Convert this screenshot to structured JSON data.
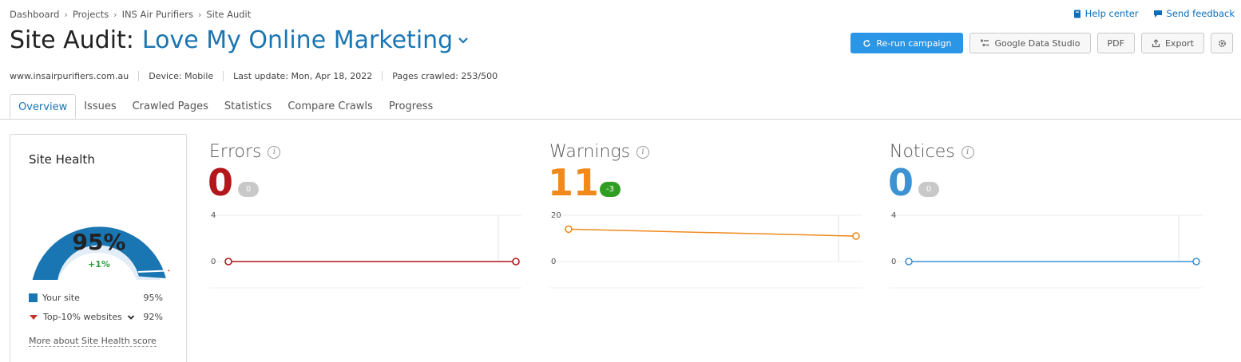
{
  "breadcrumb": [
    "Dashboard",
    "Projects",
    "INS Air Purifiers",
    "Site Audit"
  ],
  "top_links": {
    "help": "Help center",
    "feedback": "Send feedback"
  },
  "title": {
    "static": "Site Audit:",
    "project": "Love My Online Marketing"
  },
  "actions": {
    "rerun": "Re-run campaign",
    "gds": "Google Data Studio",
    "pdf": "PDF",
    "export": "Export"
  },
  "meta": {
    "domain": "www.insairpurifiers.com.au",
    "device": "Device: Mobile",
    "last_update": "Last update: Mon, Apr 18, 2022",
    "pages_crawled": "Pages crawled: 253/500"
  },
  "tabs": [
    "Overview",
    "Issues",
    "Crawled Pages",
    "Statistics",
    "Compare Crawls",
    "Progress"
  ],
  "active_tab": "Overview",
  "site_health": {
    "title": "Site Health",
    "score": "95%",
    "score_value": 95,
    "top10_value": 92,
    "delta": "+1%",
    "legend": [
      {
        "label": "Your site",
        "value": "95%"
      },
      {
        "label": "Top-10% websites",
        "value": "92%"
      }
    ],
    "link": "More about Site Health score"
  },
  "metrics": [
    {
      "name": "Errors",
      "value": "0",
      "badge": "0",
      "color": "#b3161b",
      "badge_color": "#c8c8c8",
      "chart": {
        "ymax_label": "4",
        "ymin_label": "0",
        "ymax": 4,
        "points": [
          0,
          0
        ]
      }
    },
    {
      "name": "Warnings",
      "value": "11",
      "badge": "-3",
      "color": "#f08a1d",
      "badge_color": "#2f9e22",
      "chart": {
        "ymax_label": "20",
        "ymin_label": "0",
        "ymax": 20,
        "points": [
          14,
          11
        ]
      }
    },
    {
      "name": "Notices",
      "value": "0",
      "badge": "0",
      "color": "#3d92d2",
      "badge_color": "#c8c8c8",
      "chart": {
        "ymax_label": "4",
        "ymin_label": "0",
        "ymax": 4,
        "points": [
          0,
          0
        ]
      }
    }
  ],
  "colors": {
    "accent": "#1a76b3",
    "primary_button": "#2c96e6",
    "positive": "#2c9e3a",
    "marker": "#c0322a"
  }
}
